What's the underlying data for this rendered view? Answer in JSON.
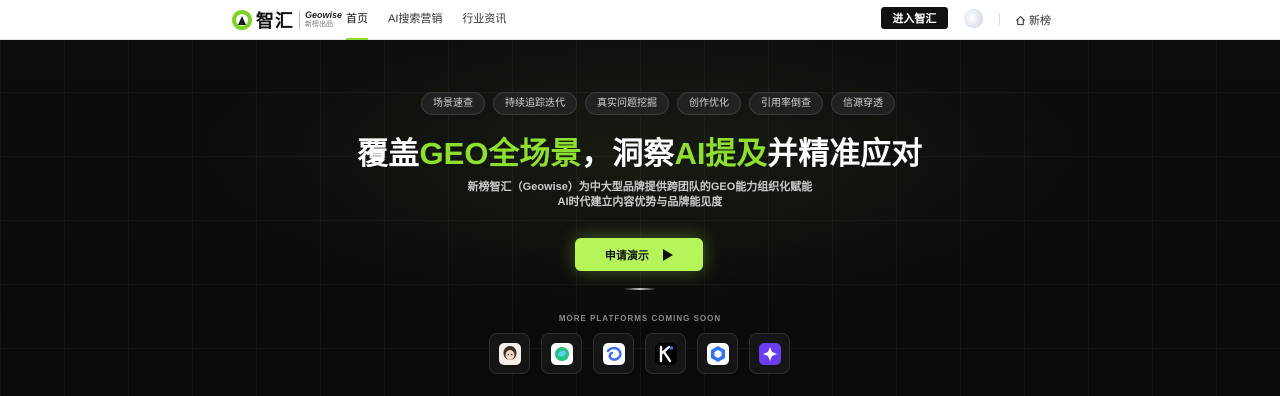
{
  "brand": {
    "name_cn": "智汇",
    "name_en": "Geowise",
    "byline": "新榜出品"
  },
  "nav": {
    "items": [
      {
        "label": "首页",
        "active": true
      },
      {
        "label": "AI搜索营销",
        "active": false
      },
      {
        "label": "行业资讯",
        "active": false
      }
    ]
  },
  "header": {
    "enter_label": "进入智汇",
    "home_label": "新榜",
    "home_icon": "home-icon"
  },
  "hero": {
    "tags": [
      "场景速查",
      "持续追踪迭代",
      "真实问题挖掘",
      "创作优化",
      "引用率倒查",
      "信源穿透"
    ],
    "headline": {
      "p1": "覆盖",
      "p2": "GEO全场景",
      "p3": "，洞察",
      "p4": "AI提及",
      "p5": "并精准应对"
    },
    "sub1": "新榜智汇（Geowise）为中大型品牌提供跨团队的GEO能力组织化赋能",
    "sub2": "AI时代建立内容优势与品牌能见度",
    "cta_label": "申请演示",
    "coming_soon": "MORE PLATFORMS COMING SOON",
    "platform_icons": [
      "doubao-icon",
      "wenxin-icon",
      "tencent-yuanbao-icon",
      "kimi-icon",
      "tongyi-icon",
      "ai-assistant-icon"
    ]
  },
  "colors": {
    "accent": "#8ee02f",
    "cta_bg": "#b6f55a",
    "dark_bg": "#0b0b0b"
  }
}
